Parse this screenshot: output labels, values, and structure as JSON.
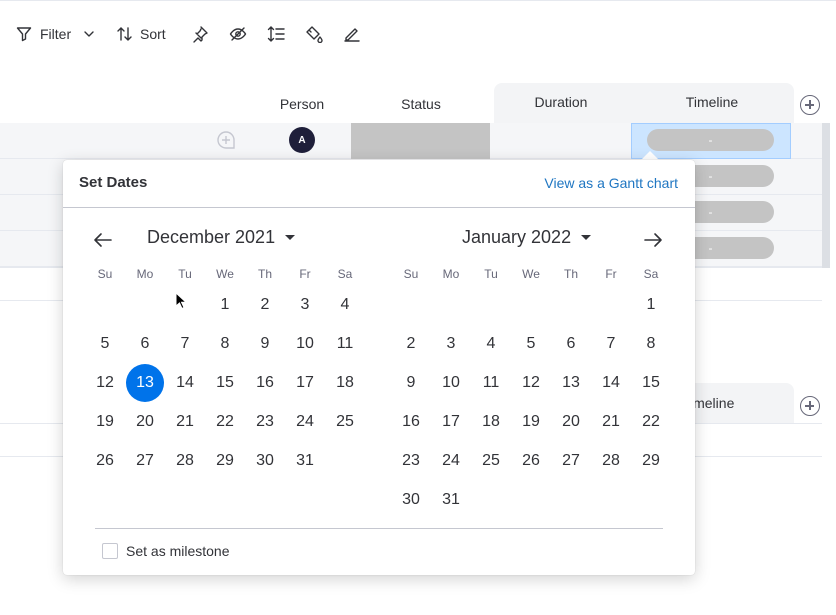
{
  "toolbar": {
    "filter_label": "Filter",
    "sort_label": "Sort",
    "icons": [
      "funnel-icon",
      "chevron-down-icon",
      "sort-arrows-icon",
      "pin-icon",
      "eye-off-icon",
      "row-height-icon",
      "paint-bucket-icon",
      "pencil-icon"
    ]
  },
  "board": {
    "columns": {
      "person": "Person",
      "status": "Status",
      "duration": "Duration",
      "timeline": "Timeline"
    },
    "rows": [
      {
        "person_initial": "A",
        "timeline": "-"
      },
      {
        "timeline": "-"
      },
      {
        "timeline": "-"
      },
      {
        "timeline": "-"
      }
    ],
    "group2_timeline_header": "imeline"
  },
  "date_picker": {
    "title": "Set Dates",
    "gantt_link": "View as a Gantt chart",
    "weekdays": [
      "Su",
      "Mo",
      "Tu",
      "We",
      "Th",
      "Fr",
      "Sa"
    ],
    "left_month": {
      "title": "December 2021",
      "days": [
        "",
        "",
        "",
        "1",
        "2",
        "3",
        "4",
        "5",
        "6",
        "7",
        "8",
        "9",
        "10",
        "11",
        "12",
        "13",
        "14",
        "15",
        "16",
        "17",
        "18",
        "19",
        "20",
        "21",
        "22",
        "23",
        "24",
        "25",
        "26",
        "27",
        "28",
        "29",
        "30",
        "31"
      ],
      "selected_day": "13"
    },
    "right_month": {
      "title": "January 2022",
      "days": [
        "",
        "",
        "",
        "",
        "",
        "",
        "1",
        "2",
        "3",
        "4",
        "5",
        "6",
        "7",
        "8",
        "9",
        "10",
        "11",
        "12",
        "13",
        "14",
        "15",
        "16",
        "17",
        "18",
        "19",
        "20",
        "21",
        "22",
        "23",
        "24",
        "25",
        "26",
        "27",
        "28",
        "29",
        "30",
        "31"
      ]
    },
    "milestone_label": "Set as milestone",
    "milestone_checked": false
  },
  "colors": {
    "accent": "#0073ea",
    "link": "#1f76c2",
    "status_gray": "#c4c4c4",
    "timeline_selected": "#cce5ff",
    "avatar": "#1f1f3a"
  }
}
